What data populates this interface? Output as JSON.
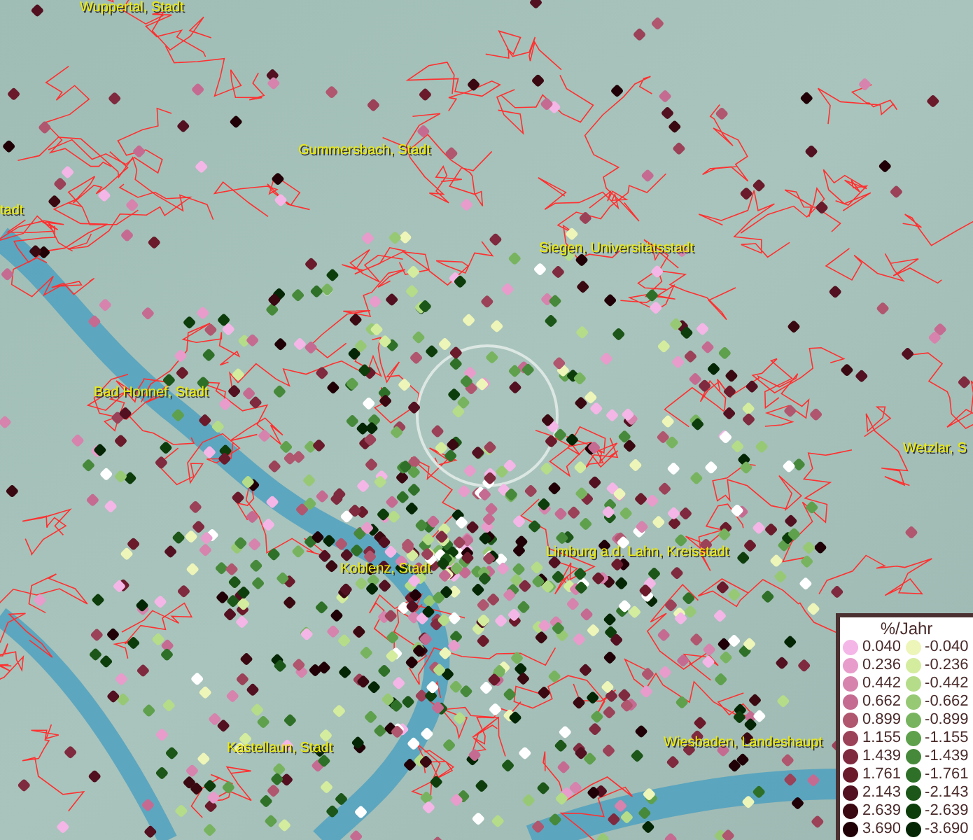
{
  "map": {
    "place_labels": [
      {
        "text": "Wuppertal, Stadt"
      },
      {
        "text": "Gummersbach, Stadt"
      },
      {
        "text": "tadt"
      },
      {
        "text": "Siegen, Universitätsstadt"
      },
      {
        "text": "Bad Honnef, Stadt"
      },
      {
        "text": "Wetzlar, S"
      },
      {
        "text": "Limburg a.d. Lahn, Kreisstadt"
      },
      {
        "text": "Koblenz, Stadt"
      },
      {
        "text": "Kastellaun, Stadt"
      },
      {
        "text": "Wiesbaden, Landeshaupt"
      }
    ]
  },
  "legend": {
    "title": "%/Jahr",
    "positive": [
      {
        "label": "0.040",
        "color": "#f4b6e6"
      },
      {
        "label": "0.236",
        "color": "#e89ccb"
      },
      {
        "label": "0.442",
        "color": "#d683ad"
      },
      {
        "label": "0.662",
        "color": "#c56b92"
      },
      {
        "label": "0.899",
        "color": "#b0566f"
      },
      {
        "label": "1.155",
        "color": "#9b4158"
      },
      {
        "label": "1.439",
        "color": "#7f2a3e"
      },
      {
        "label": "1.761",
        "color": "#6a1a2a"
      },
      {
        "label": "2.143",
        "color": "#521020"
      },
      {
        "label": "2.639",
        "color": "#3a0810"
      },
      {
        "label": "3.690",
        "color": "#200006"
      }
    ],
    "negative": [
      {
        "label": "-0.040",
        "color": "#eef5b8"
      },
      {
        "label": "-0.236",
        "color": "#d4ec9e"
      },
      {
        "label": "-0.442",
        "color": "#b5dc88"
      },
      {
        "label": "-0.662",
        "color": "#97c975"
      },
      {
        "label": "-0.899",
        "color": "#78b45f"
      },
      {
        "label": "-1.155",
        "color": "#5ea04c"
      },
      {
        "label": "-1.439",
        "color": "#47893b"
      },
      {
        "label": "-1.761",
        "color": "#2f7028"
      },
      {
        "label": "-2.143",
        "color": "#1c5618"
      },
      {
        "label": "-2.639",
        "color": "#0e3d0c"
      },
      {
        "label": "-3.690",
        "color": "#052605"
      }
    ]
  }
}
